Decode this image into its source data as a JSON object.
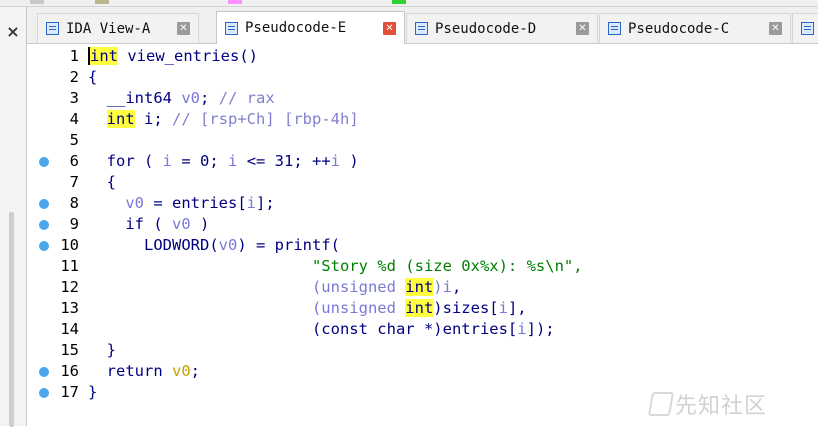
{
  "tabs": [
    {
      "label": "IDA View-A",
      "active": false
    },
    {
      "label": "Pseudocode-E",
      "active": true
    },
    {
      "label": "Pseudocode-D",
      "active": false
    },
    {
      "label": "Pseudocode-C",
      "active": false
    }
  ],
  "left_panel": {
    "close_glyph": "×"
  },
  "code": {
    "line_numbers": [
      "1",
      "2",
      "3",
      "4",
      "5",
      "6",
      "7",
      "8",
      "9",
      "10",
      "11",
      "12",
      "13",
      "14",
      "15",
      "16",
      "17"
    ],
    "breakpoint_lines": [
      6,
      8,
      9,
      10,
      16,
      17
    ],
    "lines": {
      "l1_type": "int",
      "l1_rest": " view_entries()",
      "l2": "{",
      "l3_type": "__int64",
      "l3_var": "v0",
      "l3_cmt": "// rax",
      "l4_type": "int",
      "l4_var": "i",
      "l4_cmt": "// [rsp+Ch] [rbp-4h]",
      "l6_for": "for",
      "l6_i1": "i",
      "l6_eq": " = 0; ",
      "l6_i2": "i",
      "l6_le": " <= 31; ++",
      "l6_i3": "i",
      "l6_end": " )",
      "l7": "{",
      "l8_v0": "v0",
      "l8_mid": " = entries[",
      "l8_i": "i",
      "l8_end": "];",
      "l9_if": "if ( ",
      "l9_v0": "v0",
      "l9_end": " )",
      "l10_fn": "LODWORD(",
      "l10_v0": "v0",
      "l10_end": ") = printf(",
      "l11_str": "\"Story %d (size 0x%x): %s\\n\",",
      "l12_a": "(unsigned ",
      "l12_int": "int",
      "l12_b": ")",
      "l12_i": "i",
      "l12_c": ",",
      "l13_a": "(unsigned ",
      "l13_int": "int",
      "l13_b": ")sizes[",
      "l13_i": "i",
      "l13_c": "],",
      "l14_a": "(const char *)entries[",
      "l14_i": "i",
      "l14_c": "]);",
      "l15": "}",
      "l16_ret": "return ",
      "l16_v0": "v0",
      "l16_end": ";",
      "l17": "}"
    }
  },
  "watermark": {
    "text": "先知社区"
  },
  "colors": {
    "keyword": "#000080",
    "variable": "#7a7ad6",
    "string": "#008000",
    "highlight": "#ffff40",
    "breakpoint": "#4aa7ee",
    "active_tab_close": "#e0503a"
  }
}
